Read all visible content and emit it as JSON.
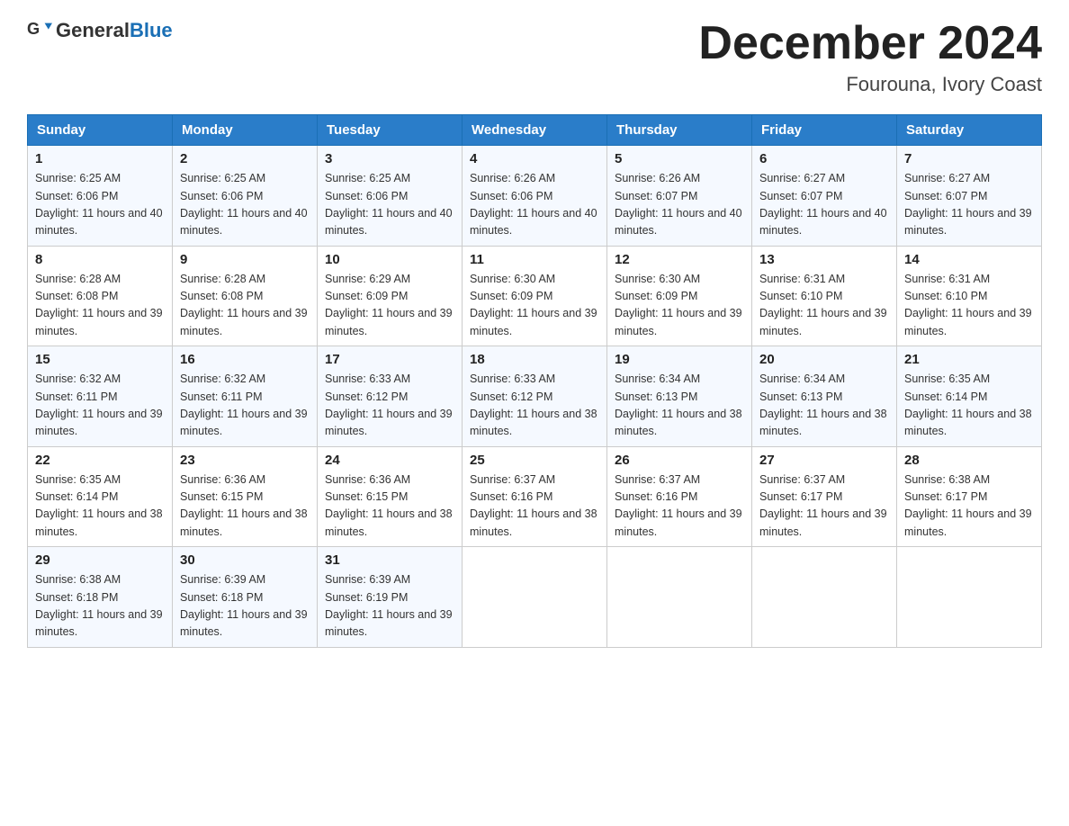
{
  "logo": {
    "general": "General",
    "blue": "Blue"
  },
  "header": {
    "month": "December 2024",
    "location": "Fourouna, Ivory Coast"
  },
  "days_of_week": [
    "Sunday",
    "Monday",
    "Tuesday",
    "Wednesday",
    "Thursday",
    "Friday",
    "Saturday"
  ],
  "weeks": [
    [
      {
        "day": "1",
        "sunrise": "6:25 AM",
        "sunset": "6:06 PM",
        "daylight": "11 hours and 40 minutes."
      },
      {
        "day": "2",
        "sunrise": "6:25 AM",
        "sunset": "6:06 PM",
        "daylight": "11 hours and 40 minutes."
      },
      {
        "day": "3",
        "sunrise": "6:25 AM",
        "sunset": "6:06 PM",
        "daylight": "11 hours and 40 minutes."
      },
      {
        "day": "4",
        "sunrise": "6:26 AM",
        "sunset": "6:06 PM",
        "daylight": "11 hours and 40 minutes."
      },
      {
        "day": "5",
        "sunrise": "6:26 AM",
        "sunset": "6:07 PM",
        "daylight": "11 hours and 40 minutes."
      },
      {
        "day": "6",
        "sunrise": "6:27 AM",
        "sunset": "6:07 PM",
        "daylight": "11 hours and 40 minutes."
      },
      {
        "day": "7",
        "sunrise": "6:27 AM",
        "sunset": "6:07 PM",
        "daylight": "11 hours and 39 minutes."
      }
    ],
    [
      {
        "day": "8",
        "sunrise": "6:28 AM",
        "sunset": "6:08 PM",
        "daylight": "11 hours and 39 minutes."
      },
      {
        "day": "9",
        "sunrise": "6:28 AM",
        "sunset": "6:08 PM",
        "daylight": "11 hours and 39 minutes."
      },
      {
        "day": "10",
        "sunrise": "6:29 AM",
        "sunset": "6:09 PM",
        "daylight": "11 hours and 39 minutes."
      },
      {
        "day": "11",
        "sunrise": "6:30 AM",
        "sunset": "6:09 PM",
        "daylight": "11 hours and 39 minutes."
      },
      {
        "day": "12",
        "sunrise": "6:30 AM",
        "sunset": "6:09 PM",
        "daylight": "11 hours and 39 minutes."
      },
      {
        "day": "13",
        "sunrise": "6:31 AM",
        "sunset": "6:10 PM",
        "daylight": "11 hours and 39 minutes."
      },
      {
        "day": "14",
        "sunrise": "6:31 AM",
        "sunset": "6:10 PM",
        "daylight": "11 hours and 39 minutes."
      }
    ],
    [
      {
        "day": "15",
        "sunrise": "6:32 AM",
        "sunset": "6:11 PM",
        "daylight": "11 hours and 39 minutes."
      },
      {
        "day": "16",
        "sunrise": "6:32 AM",
        "sunset": "6:11 PM",
        "daylight": "11 hours and 39 minutes."
      },
      {
        "day": "17",
        "sunrise": "6:33 AM",
        "sunset": "6:12 PM",
        "daylight": "11 hours and 39 minutes."
      },
      {
        "day": "18",
        "sunrise": "6:33 AM",
        "sunset": "6:12 PM",
        "daylight": "11 hours and 38 minutes."
      },
      {
        "day": "19",
        "sunrise": "6:34 AM",
        "sunset": "6:13 PM",
        "daylight": "11 hours and 38 minutes."
      },
      {
        "day": "20",
        "sunrise": "6:34 AM",
        "sunset": "6:13 PM",
        "daylight": "11 hours and 38 minutes."
      },
      {
        "day": "21",
        "sunrise": "6:35 AM",
        "sunset": "6:14 PM",
        "daylight": "11 hours and 38 minutes."
      }
    ],
    [
      {
        "day": "22",
        "sunrise": "6:35 AM",
        "sunset": "6:14 PM",
        "daylight": "11 hours and 38 minutes."
      },
      {
        "day": "23",
        "sunrise": "6:36 AM",
        "sunset": "6:15 PM",
        "daylight": "11 hours and 38 minutes."
      },
      {
        "day": "24",
        "sunrise": "6:36 AM",
        "sunset": "6:15 PM",
        "daylight": "11 hours and 38 minutes."
      },
      {
        "day": "25",
        "sunrise": "6:37 AM",
        "sunset": "6:16 PM",
        "daylight": "11 hours and 38 minutes."
      },
      {
        "day": "26",
        "sunrise": "6:37 AM",
        "sunset": "6:16 PM",
        "daylight": "11 hours and 39 minutes."
      },
      {
        "day": "27",
        "sunrise": "6:37 AM",
        "sunset": "6:17 PM",
        "daylight": "11 hours and 39 minutes."
      },
      {
        "day": "28",
        "sunrise": "6:38 AM",
        "sunset": "6:17 PM",
        "daylight": "11 hours and 39 minutes."
      }
    ],
    [
      {
        "day": "29",
        "sunrise": "6:38 AM",
        "sunset": "6:18 PM",
        "daylight": "11 hours and 39 minutes."
      },
      {
        "day": "30",
        "sunrise": "6:39 AM",
        "sunset": "6:18 PM",
        "daylight": "11 hours and 39 minutes."
      },
      {
        "day": "31",
        "sunrise": "6:39 AM",
        "sunset": "6:19 PM",
        "daylight": "11 hours and 39 minutes."
      },
      null,
      null,
      null,
      null
    ]
  ]
}
